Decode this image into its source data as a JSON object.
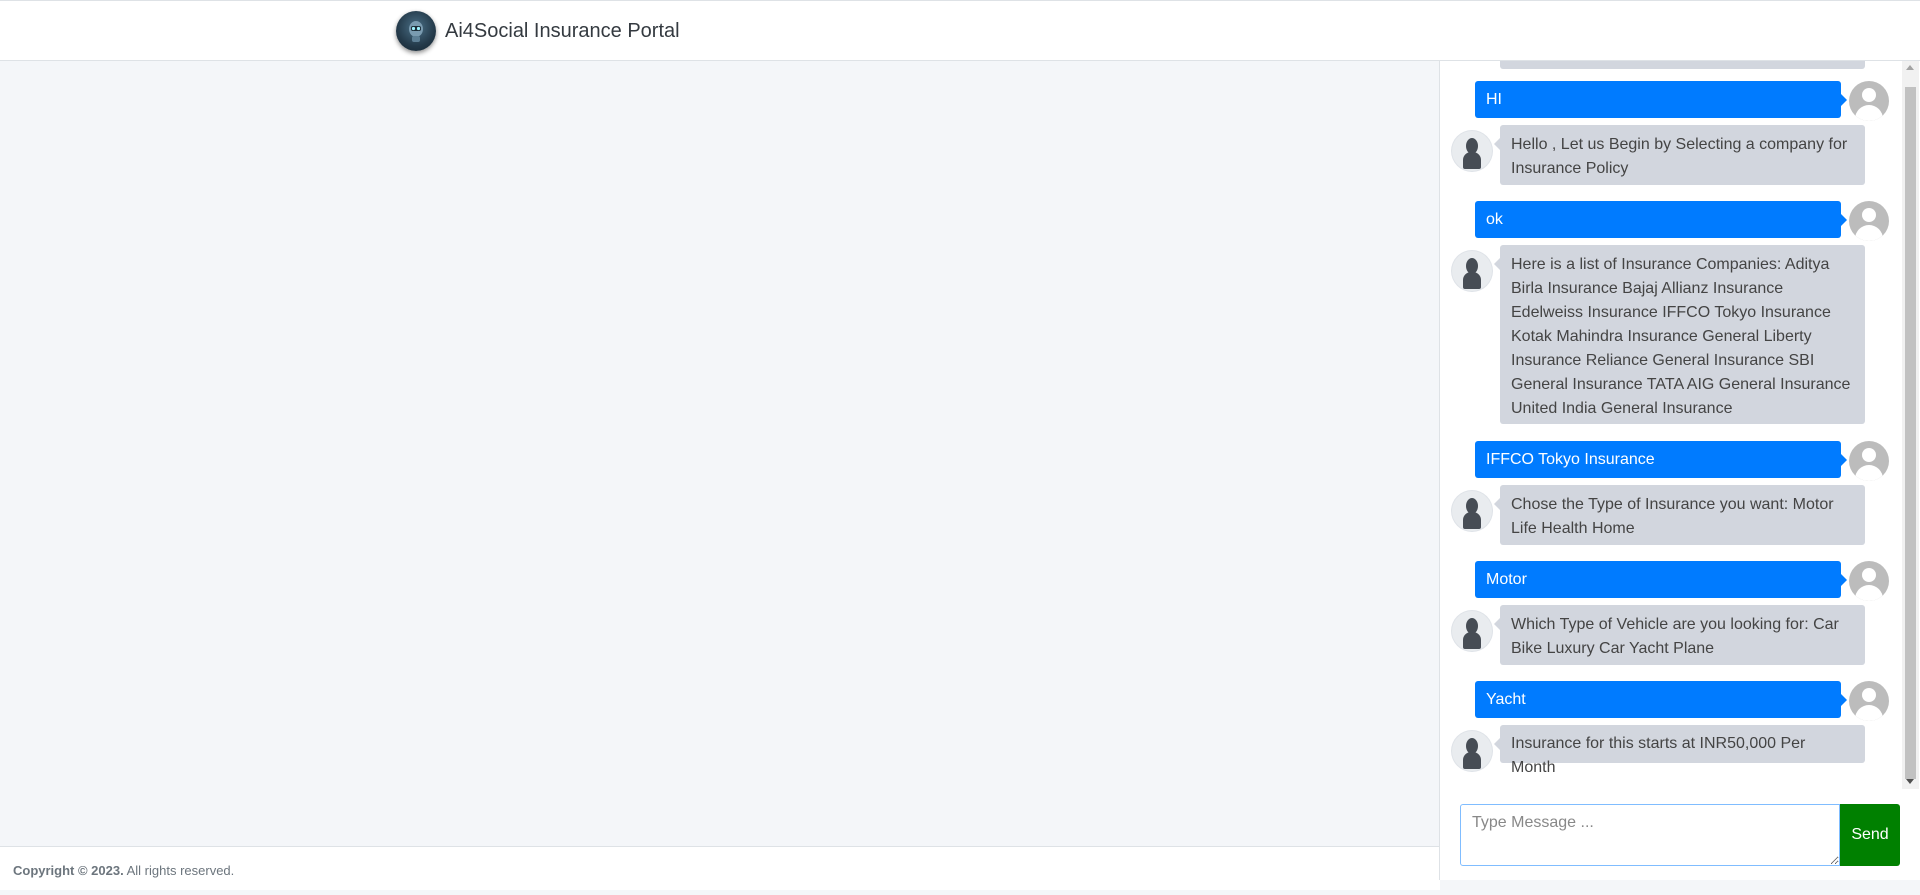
{
  "app": {
    "title": "Ai4Social Insurance Portal",
    "logo_icon": "robot-logo-icon"
  },
  "footer": {
    "copyright": "Copyright © 2023.",
    "rights": " All rights reserved."
  },
  "chat": {
    "messages": [
      {
        "from": "user",
        "text": "HI"
      },
      {
        "from": "bot",
        "text": "Hello , Let us Begin by Selecting a company for Insurance Policy"
      },
      {
        "from": "user",
        "text": "ok"
      },
      {
        "from": "bot",
        "text": "Here is a list of Insurance Companies: Aditya Birla Insurance Bajaj Allianz Insurance Edelweiss Insurance IFFCO Tokyo Insurance Kotak Mahindra Insurance General Liberty Insurance Reliance General Insurance SBI General Insurance TATA AIG General Insurance United India General Insurance"
      },
      {
        "from": "user",
        "text": "IFFCO Tokyo Insurance"
      },
      {
        "from": "bot",
        "text": "Chose the Type of Insurance you want: Motor Life Health Home"
      },
      {
        "from": "user",
        "text": "Motor"
      },
      {
        "from": "bot",
        "text": "Which Type of Vehicle are you looking for: Car Bike Luxury Car Yacht Plane"
      },
      {
        "from": "user",
        "text": "Yacht"
      },
      {
        "from": "bot",
        "text": "Insurance for this starts at INR50,000 Per Month"
      }
    ],
    "input_placeholder": "Type Message ...",
    "send_label": "Send"
  },
  "colors": {
    "user_bubble": "#007bff",
    "bot_bubble": "#d2d6de",
    "send_button": "#008000"
  }
}
